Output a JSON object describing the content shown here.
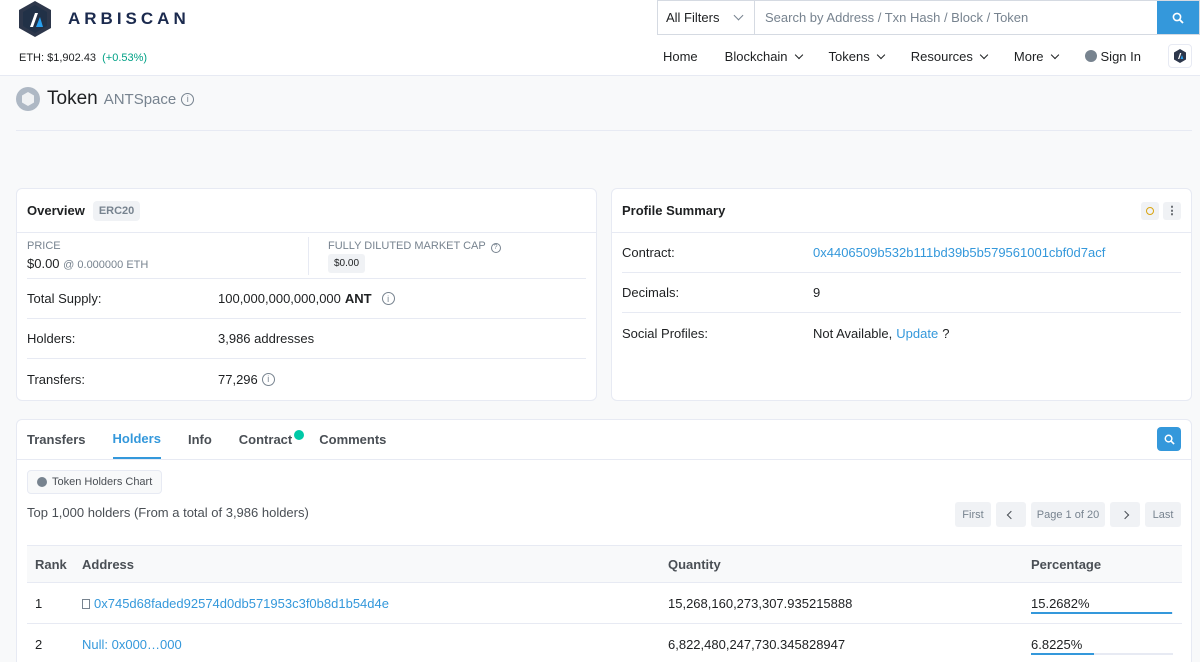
{
  "header": {
    "brand": "ARBISCAN",
    "eth_price_label": "ETH: $1,902.43",
    "eth_change": "(+0.53%)",
    "filter_label": "All Filters",
    "search_placeholder": "Search by Address / Txn Hash / Block / Token",
    "nav": [
      {
        "label": "Home"
      },
      {
        "label": "Blockchain"
      },
      {
        "label": "Tokens"
      },
      {
        "label": "Resources"
      },
      {
        "label": "More"
      },
      {
        "label": "Sign In"
      }
    ]
  },
  "page": {
    "title": "Token",
    "token_name": "ANTSpace"
  },
  "overview": {
    "title": "Overview",
    "badge": "ERC20",
    "price_label": "PRICE",
    "price_value": "$0.00",
    "price_eth": "@ 0.000000 ETH",
    "mcap_label": "FULLY DILUTED MARKET CAP",
    "mcap_value": "$0.00",
    "total_supply_label": "Total Supply:",
    "total_supply_value": "100,000,000,000,000",
    "total_supply_unit": "ANT",
    "holders_label": "Holders:",
    "holders_value": "3,986 addresses",
    "transfers_label": "Transfers:",
    "transfers_value": "77,296"
  },
  "profile": {
    "title": "Profile Summary",
    "contract_label": "Contract:",
    "contract_value": "0x4406509b532b111bd39b5b579561001cbf0d7acf",
    "decimals_label": "Decimals:",
    "decimals_value": "9",
    "social_label": "Social Profiles:",
    "social_value": "Not Available,",
    "social_link": "Update",
    "social_suffix": "?"
  },
  "tabs": [
    {
      "label": "Transfers"
    },
    {
      "label": "Holders"
    },
    {
      "label": "Info"
    },
    {
      "label": "Contract"
    },
    {
      "label": "Comments"
    }
  ],
  "holders": {
    "chart_button": "Token Holders Chart",
    "summary": "Top 1,000 holders (From a total of 3,986 holders)",
    "pager": {
      "first": "First",
      "page": "Page 1 of 20",
      "last": "Last"
    },
    "columns": [
      "Rank",
      "Address",
      "Quantity",
      "Percentage"
    ],
    "rows": [
      {
        "rank": "1",
        "address": "0x745d68faded92574d0db571953c3f0b8d1b54d4e",
        "quantity": "15,268,160,273,307.935215888",
        "percentage": "15.2682%",
        "pct": 0.152682
      },
      {
        "rank": "2",
        "address": "Null: 0x000…000",
        "quantity": "6,822,480,247,730.345828947",
        "percentage": "6.8225%",
        "pct": 0.068225
      }
    ]
  },
  "colors": {
    "accent": "#3498db",
    "positive": "#00a186"
  }
}
